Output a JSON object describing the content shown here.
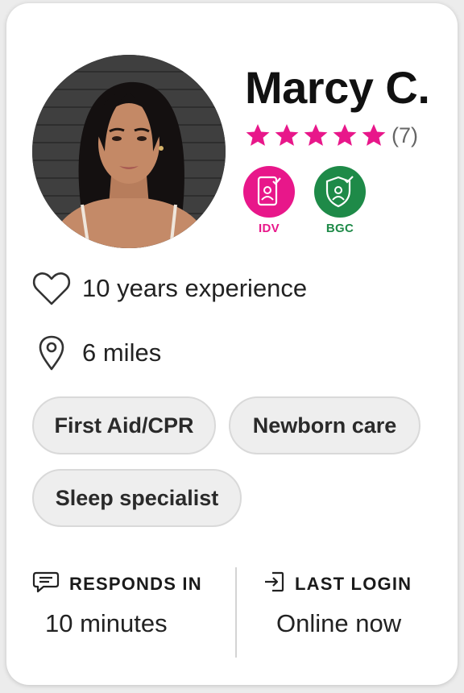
{
  "profile": {
    "name": "Marcy C.",
    "rating": 5,
    "review_count": "(7)",
    "accent_color": "#e8178a"
  },
  "badges": [
    {
      "label": "IDV",
      "icon": "id-verified-icon",
      "color": "#e8178a"
    },
    {
      "label": "BGC",
      "icon": "background-check-shield-icon",
      "color": "#1e8a48"
    }
  ],
  "details": {
    "experience": "10 years experience",
    "experience_icon": "heart-icon",
    "distance": "6 miles",
    "distance_icon": "location-pin-icon"
  },
  "skills": [
    "First Aid/CPR",
    "Newborn care",
    "Sleep specialist"
  ],
  "stats": {
    "responds_label": "RESPONDS IN",
    "responds_value": "10 minutes",
    "responds_icon": "chat-bubble-icon",
    "login_label": "LAST LOGIN",
    "login_value": "Online now",
    "login_icon": "login-arrow-icon"
  }
}
